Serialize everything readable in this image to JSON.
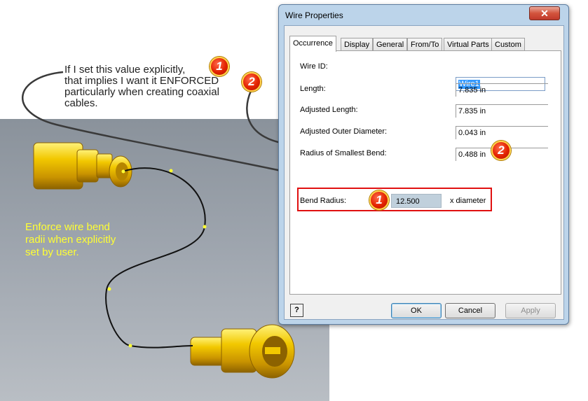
{
  "annotation": {
    "note_line1": "If I set this value explicitly,",
    "note_line2": "that implies I want it ENFORCED",
    "note_line3": "particularly when creating coaxial",
    "note_line4": "cables.",
    "yellow_line1": "Enforce wire bend",
    "yellow_line2": "radii when explicitly",
    "yellow_line3": "set by user.",
    "badge_1": "1",
    "badge_2": "2"
  },
  "dialog": {
    "title": "Wire Properties",
    "close_glyph": "✕",
    "tabs": [
      "Occurrence",
      "Display",
      "General",
      "From/To",
      "Virtual Parts",
      "Custom"
    ],
    "fields": {
      "wire_id_label": "Wire ID:",
      "wire_id_value": "Wire1",
      "length_label": "Length:",
      "length_value": "7.835 in",
      "adj_length_label": "Adjusted Length:",
      "adj_length_value": "7.835 in",
      "adj_outer_label": "Adjusted Outer Diameter:",
      "adj_outer_value": "0.043 in",
      "smallest_bend_label": "Radius of Smallest Bend:",
      "smallest_bend_value": "0.488 in",
      "bend_radius_label": "Bend Radius:",
      "bend_radius_value": "12.500",
      "bend_radius_unit": "x diameter"
    },
    "buttons": {
      "help": "?",
      "ok": "OK",
      "cancel": "Cancel",
      "apply": "Apply"
    }
  },
  "colors": {
    "accent_red": "#e01010",
    "note_yellow": "#ffff33",
    "connector_gold": "#e8b400"
  }
}
